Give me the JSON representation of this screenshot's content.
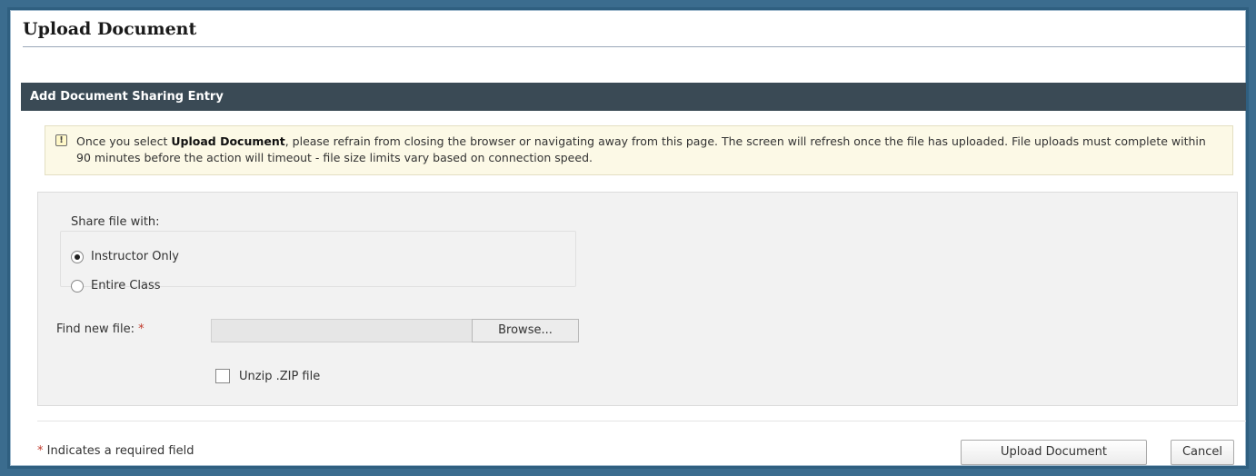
{
  "page": {
    "title": "Upload Document"
  },
  "section": {
    "title": "Add Document Sharing Entry"
  },
  "notice": {
    "before_bold": "Once you select ",
    "bold": "Upload Document",
    "after_bold": ", please refrain from closing the browser or navigating away from this page. The screen will refresh once the file has uploaded. File uploads must complete within 90 minutes before the action will timeout - file size limits vary based on connection speed.",
    "icon": "info-note-icon"
  },
  "share": {
    "label": "Share file with:",
    "options": [
      {
        "label": "Instructor Only",
        "selected": true
      },
      {
        "label": "Entire Class",
        "selected": false
      }
    ]
  },
  "file": {
    "label": "Find new file:",
    "required_mark": "*",
    "value": "",
    "browse_label": "Browse..."
  },
  "unzip": {
    "label": "Unzip .ZIP file",
    "checked": false
  },
  "footer": {
    "required_mark": "*",
    "required_note": "Indicates a required field",
    "upload_label": "Upload Document",
    "cancel_label": "Cancel"
  }
}
